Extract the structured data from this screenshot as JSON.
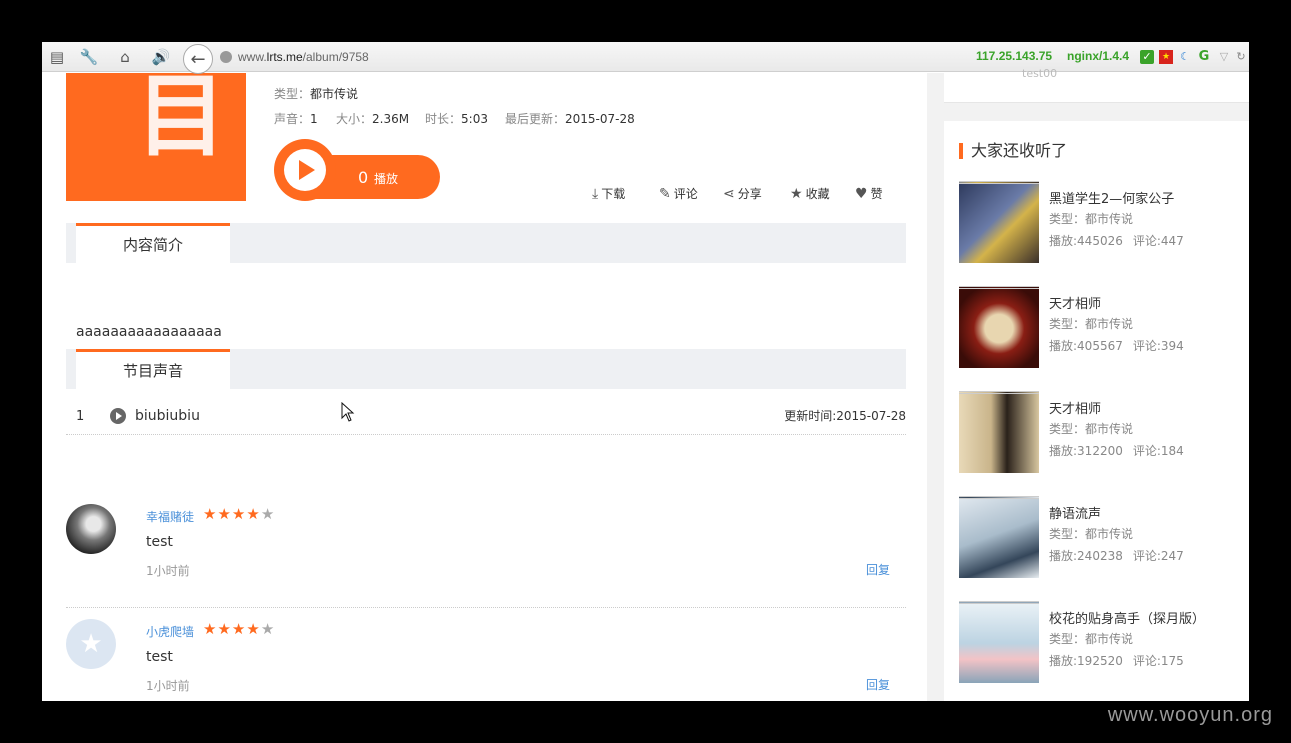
{
  "browser": {
    "url_prefix": "www.",
    "url_host": "lrts.me",
    "url_path": "/album/9758",
    "ip": "117.25.143.75",
    "server": "nginx/1.4.4"
  },
  "album": {
    "type_label": "类型：",
    "type_value": "都市传说",
    "sounds_label": "声音：",
    "sounds_value": "1",
    "size_label": "大小：",
    "size_value": "2.36M",
    "duration_label": "时长：",
    "duration_value": "5:03",
    "updated_label": "最后更新：",
    "updated_value": "2015-07-28",
    "play_count": "0",
    "play_label": "播放"
  },
  "actions": {
    "download": "下载",
    "comment": "评论",
    "share": "分享",
    "favorite": "收藏",
    "like": "赞"
  },
  "intro": {
    "tab": "内容简介",
    "text": "aaaaaaaaaaaaaaaaa"
  },
  "episodes": {
    "tab": "节目声音",
    "items": [
      {
        "num": "1",
        "title": "biubiubiu",
        "updated": "更新时间:2015-07-28"
      }
    ]
  },
  "comments": [
    {
      "user": "幸福赌徒",
      "rating": 4,
      "text": "test",
      "time": "1小时前",
      "reply": "回复"
    },
    {
      "user": "小虎爬墙",
      "rating": 4,
      "text": "test",
      "time": "1小时前",
      "reply": "回复"
    }
  ],
  "sidebar": {
    "top_text": "test00",
    "rec_title": "大家还收听了",
    "items": [
      {
        "title": "黑道学生2—何家公子",
        "type": "类型：都市传说",
        "plays": "播放:445026",
        "comments": "评论:447"
      },
      {
        "title": "天才相师",
        "type": "类型：都市传说",
        "plays": "播放:405567",
        "comments": "评论:394"
      },
      {
        "title": "天才相师",
        "type": "类型：都市传说",
        "plays": "播放:312200",
        "comments": "评论:184"
      },
      {
        "title": "静语流声",
        "type": "类型：都市传说",
        "plays": "播放:240238",
        "comments": "评论:247"
      },
      {
        "title": "校花的贴身高手（探月版）",
        "type": "类型：都市传说",
        "plays": "播放:192520",
        "comments": "评论:175"
      }
    ]
  },
  "watermark": "www.wooyun.org",
  "colors": {
    "accent": "#ff6a1f",
    "link": "#4a90d9",
    "ip_green": "#3aa32a"
  }
}
